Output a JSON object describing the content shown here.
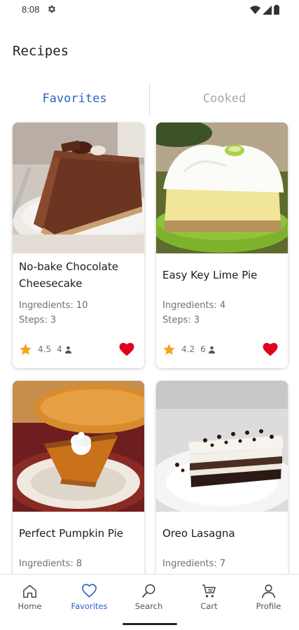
{
  "status_bar": {
    "time": "8:08"
  },
  "title": "Recipes",
  "tabs": [
    {
      "label": "Favorites",
      "active": true
    },
    {
      "label": "Cooked",
      "active": false
    }
  ],
  "recipes": [
    {
      "name": "No-bake Chocolate Cheesecake",
      "ingredients": "Ingredients: 10",
      "steps": "Steps: 3",
      "rating": "4.5",
      "servings": "4",
      "favorite": true
    },
    {
      "name": "Easy Key Lime Pie",
      "ingredients": "Ingredients: 4",
      "steps": "Steps: 3",
      "rating": "4.2",
      "servings": "6",
      "favorite": true
    },
    {
      "name": "Perfect Pumpkin Pie",
      "ingredients": "Ingredients: 8",
      "steps": "",
      "rating": "",
      "servings": "",
      "favorite": true
    },
    {
      "name": "Oreo Lasagna",
      "ingredients": "Ingredients: 7",
      "steps": "",
      "rating": "",
      "servings": "",
      "favorite": true
    }
  ],
  "nav": [
    {
      "label": "Home",
      "icon": "home-icon"
    },
    {
      "label": "Favorites",
      "icon": "heart-outline-icon",
      "active": true
    },
    {
      "label": "Search",
      "icon": "search-icon"
    },
    {
      "label": "Cart",
      "icon": "cart-icon"
    },
    {
      "label": "Profile",
      "icon": "person-icon"
    }
  ],
  "colors": {
    "accent": "#2a62c4",
    "heart": "#e0001b",
    "star": "#f4a41c",
    "muted_tab": "#a8a8a8"
  }
}
